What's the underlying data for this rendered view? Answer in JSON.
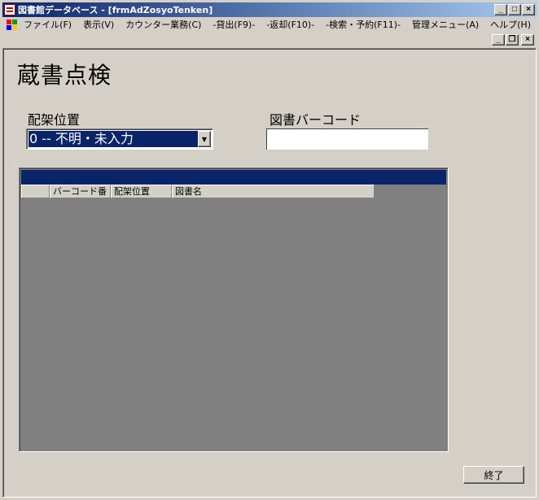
{
  "window": {
    "title": "図書館データベース - [frmAdZosyoTenken]",
    "minimize_glyph": "_",
    "maximize_glyph": "□",
    "close_glyph": "×"
  },
  "menu": {
    "items": [
      "ファイル(F)",
      "表示(V)",
      "カウンター業務(C)",
      "-貸出(F9)-",
      "-返却(F10)-",
      "-検索・予約(F11)-",
      "管理メニュー(A)",
      "ヘルプ(H)"
    ]
  },
  "mdi": {
    "minimize_glyph": "_",
    "restore_glyph": "❐",
    "close_glyph": "×"
  },
  "form": {
    "title": "蔵書点検",
    "location_label": "配架位置",
    "location_value": "0 -- 不明・未入力",
    "barcode_label": "図書バーコード",
    "barcode_value": "",
    "close_button": "終了"
  },
  "grid": {
    "columns": [
      "",
      "バーコード番",
      "配架位置",
      "図書名"
    ]
  },
  "colors": {
    "titlebar_start": "#0a246a",
    "titlebar_end": "#a6caf0",
    "face": "#d4d0c8",
    "grid_background": "#808080",
    "selection": "#0a246a"
  }
}
